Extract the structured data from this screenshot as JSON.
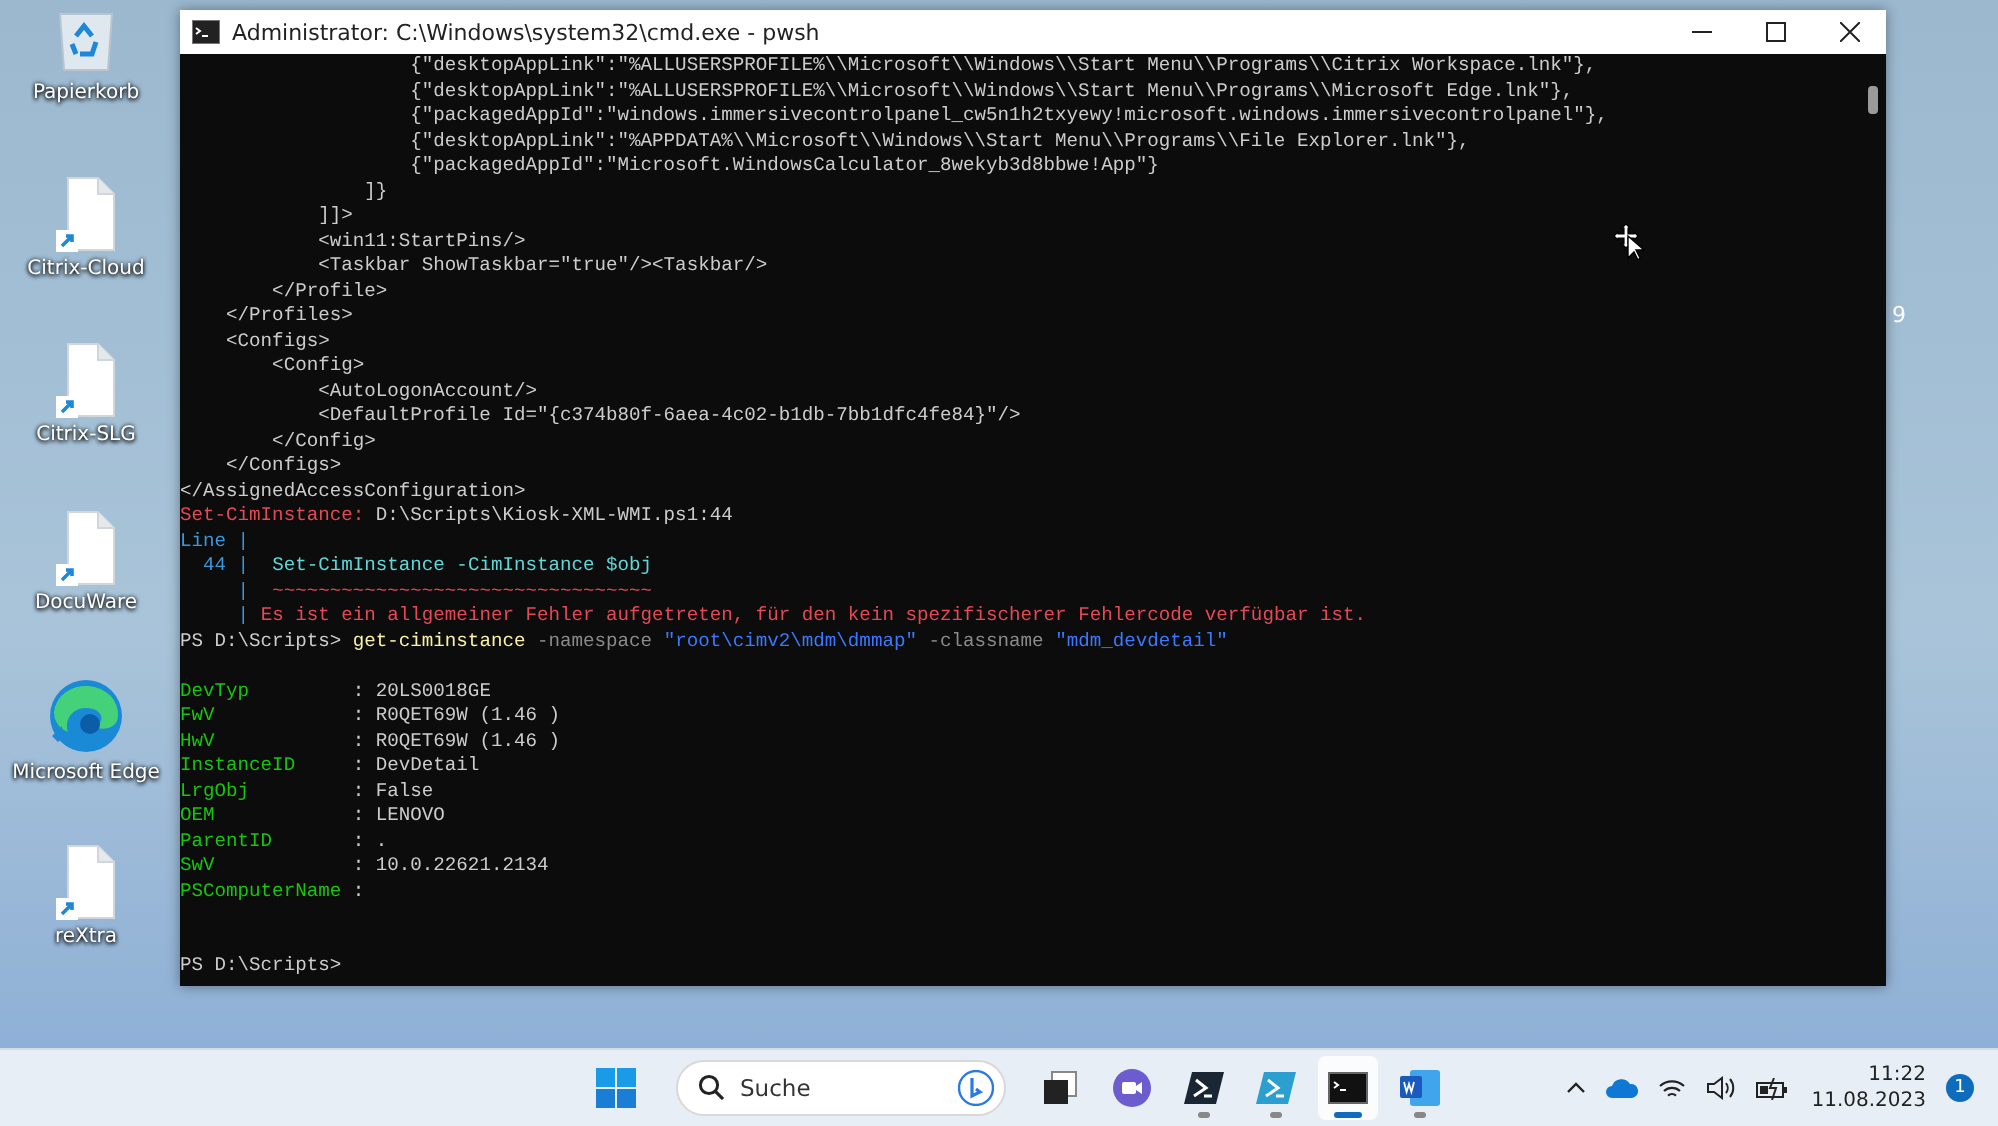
{
  "desktop": {
    "icons": [
      {
        "label": "Papierkorb",
        "kind": "recycle"
      },
      {
        "label": "Citrix-Cloud",
        "kind": "shortcut"
      },
      {
        "label": "Citrix-SLG",
        "kind": "shortcut"
      },
      {
        "label": "DocuWare",
        "kind": "shortcut"
      },
      {
        "label": "Microsoft Edge",
        "kind": "edge"
      },
      {
        "label": "reXtra",
        "kind": "shortcut"
      }
    ],
    "fragment": "9"
  },
  "window": {
    "title": "Administrator: C:\\Windows\\system32\\cmd.exe - pwsh",
    "lines": [
      {
        "segments": [
          {
            "text": "                    {\"desktopAppLink\":\"%ALLUSERSPROFILE%\\\\Microsoft\\\\Windows\\\\Start Menu\\\\Programs\\\\Citrix Workspace.lnk\"},",
            "kind": "plain"
          }
        ]
      },
      {
        "segments": [
          {
            "text": "                    {\"desktopAppLink\":\"%ALLUSERSPROFILE%\\\\Microsoft\\\\Windows\\\\Start Menu\\\\Programs\\\\Microsoft Edge.lnk\"},",
            "kind": "plain"
          }
        ]
      },
      {
        "segments": [
          {
            "text": "                    {\"packagedAppId\":\"windows.immersivecontrolpanel_cw5n1h2txyewy!microsoft.windows.immersivecontrolpanel\"},",
            "kind": "plain"
          }
        ]
      },
      {
        "segments": [
          {
            "text": "                    {\"desktopAppLink\":\"%APPDATA%\\\\Microsoft\\\\Windows\\\\Start Menu\\\\Programs\\\\File Explorer.lnk\"},",
            "kind": "plain"
          }
        ]
      },
      {
        "segments": [
          {
            "text": "                    {\"packagedAppId\":\"Microsoft.WindowsCalculator_8wekyb3d8bbwe!App\"}",
            "kind": "plain"
          }
        ]
      },
      {
        "segments": [
          {
            "text": "                ]}",
            "kind": "plain"
          }
        ]
      },
      {
        "segments": [
          {
            "text": "            ]]>",
            "kind": "plain"
          }
        ]
      },
      {
        "segments": [
          {
            "text": "            <win11:StartPins/>",
            "kind": "plain"
          }
        ]
      },
      {
        "segments": [
          {
            "text": "            <Taskbar ShowTaskbar=\"true\"/><Taskbar/>",
            "kind": "plain"
          }
        ]
      },
      {
        "segments": [
          {
            "text": "        </Profile>",
            "kind": "plain"
          }
        ]
      },
      {
        "segments": [
          {
            "text": "    </Profiles>",
            "kind": "plain"
          }
        ]
      },
      {
        "segments": [
          {
            "text": "    <Configs>",
            "kind": "plain"
          }
        ]
      },
      {
        "segments": [
          {
            "text": "        <Config>",
            "kind": "plain"
          }
        ]
      },
      {
        "segments": [
          {
            "text": "            <AutoLogonAccount/>",
            "kind": "plain"
          }
        ]
      },
      {
        "segments": [
          {
            "text": "            <DefaultProfile Id=\"{c374b80f-6aea-4c02-b1db-7bb1dfc4fe84}\"/>",
            "kind": "plain"
          }
        ]
      },
      {
        "segments": [
          {
            "text": "        </Config>",
            "kind": "plain"
          }
        ]
      },
      {
        "segments": [
          {
            "text": "    </Configs>",
            "kind": "plain"
          }
        ]
      },
      {
        "segments": [
          {
            "text": "</AssignedAccessConfiguration>",
            "kind": "plain"
          }
        ]
      },
      {
        "segments": [
          {
            "text": "Set-CimInstance: ",
            "kind": "error"
          },
          {
            "text": "D:\\Scripts\\Kiosk-XML-WMI.ps1:44",
            "kind": "plain"
          }
        ]
      },
      {
        "segments": [
          {
            "text": "Line |",
            "kind": "accent"
          }
        ]
      },
      {
        "segments": [
          {
            "text": "  44 | ",
            "kind": "accent"
          },
          {
            "text": " Set-CimInstance -CimInstance $obj",
            "kind": "code"
          }
        ]
      },
      {
        "segments": [
          {
            "text": "     | ",
            "kind": "accent"
          },
          {
            "text": " ~~~~~~~~~~~~~~~~~~~~~~~~~~~~~~~~~",
            "kind": "error"
          }
        ]
      },
      {
        "segments": [
          {
            "text": "     | ",
            "kind": "accent"
          },
          {
            "text": "Es ist ein allgemeiner Fehler aufgetreten, für den kein spezifischerer Fehlercode verfügbar ist.",
            "kind": "error"
          }
        ]
      },
      {
        "segments": [
          {
            "text": "PS D:\\Scripts> ",
            "kind": "plain"
          },
          {
            "text": "get-ciminstance",
            "kind": "command"
          },
          {
            "text": " -namespace ",
            "kind": "param"
          },
          {
            "text": "\"root\\cimv2\\mdm\\dmmap\"",
            "kind": "string"
          },
          {
            "text": " -classname ",
            "kind": "param"
          },
          {
            "text": "\"mdm_devdetail\"",
            "kind": "string"
          }
        ]
      },
      {
        "kind": "blank"
      },
      {
        "segments": [
          {
            "text": "DevTyp         ",
            "kind": "key"
          },
          {
            "text": ": 20LS0018GE",
            "kind": "plain"
          }
        ]
      },
      {
        "segments": [
          {
            "text": "FwV            ",
            "kind": "key"
          },
          {
            "text": ": R0QET69W (1.46 )",
            "kind": "plain"
          }
        ]
      },
      {
        "segments": [
          {
            "text": "HwV            ",
            "kind": "key"
          },
          {
            "text": ": R0QET69W (1.46 )",
            "kind": "plain"
          }
        ]
      },
      {
        "segments": [
          {
            "text": "InstanceID     ",
            "kind": "key"
          },
          {
            "text": ": DevDetail",
            "kind": "plain"
          }
        ]
      },
      {
        "segments": [
          {
            "text": "LrgObj         ",
            "kind": "key"
          },
          {
            "text": ": False",
            "kind": "plain"
          }
        ]
      },
      {
        "segments": [
          {
            "text": "OEM            ",
            "kind": "key"
          },
          {
            "text": ": LENOVO",
            "kind": "plain"
          }
        ]
      },
      {
        "segments": [
          {
            "text": "ParentID       ",
            "kind": "key"
          },
          {
            "text": ": .",
            "kind": "plain"
          }
        ]
      },
      {
        "segments": [
          {
            "text": "SwV            ",
            "kind": "key"
          },
          {
            "text": ": 10.0.22621.2134",
            "kind": "plain"
          }
        ]
      },
      {
        "segments": [
          {
            "text": "PSComputerName ",
            "kind": "key"
          },
          {
            "text": ":",
            "kind": "plain"
          }
        ]
      },
      {
        "kind": "blank"
      },
      {
        "kind": "blank"
      },
      {
        "segments": [
          {
            "text": "PS D:\\Scripts>",
            "kind": "plain"
          }
        ]
      }
    ]
  },
  "taskbar": {
    "search": {
      "placeholder": "Suche"
    },
    "apps": [
      {
        "kind": "taskview",
        "running": false,
        "selected": false
      },
      {
        "kind": "chat",
        "running": false,
        "selected": false
      },
      {
        "kind": "powershell",
        "running": true,
        "selected": false
      },
      {
        "kind": "powershell-ise",
        "running": true,
        "selected": false
      },
      {
        "kind": "console",
        "running": true,
        "selected": true
      },
      {
        "kind": "word",
        "running": true,
        "selected": false
      }
    ],
    "time": "11:22",
    "date": "11.08.2023",
    "notifications": "1"
  }
}
